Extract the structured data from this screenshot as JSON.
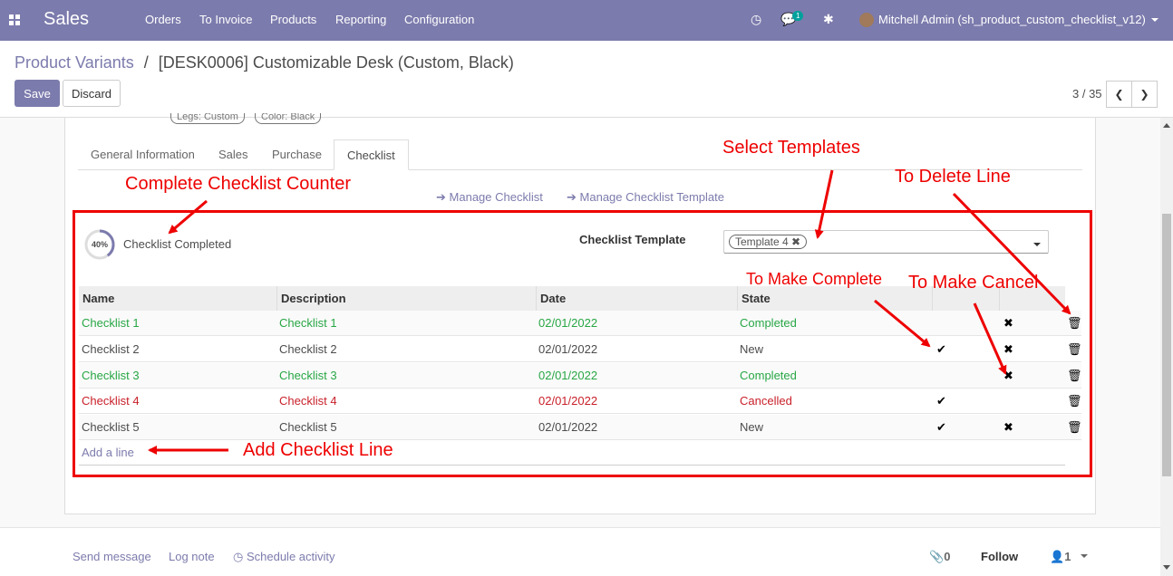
{
  "nav": {
    "app_name": "Sales",
    "menu": [
      "Orders",
      "To Invoice",
      "Products",
      "Reporting",
      "Configuration"
    ],
    "chat_badge": "1",
    "user": "Mitchell Admin (sh_product_custom_checklist_v12)"
  },
  "breadcrumb": {
    "parent": "Product Variants",
    "separator": "/",
    "current": "[DESK0006] Customizable Desk (Custom, Black)"
  },
  "buttons": {
    "save": "Save",
    "discard": "Discard"
  },
  "pager": {
    "value": "3 / 35"
  },
  "tags": [
    "Legs: Custom",
    "Color: Black"
  ],
  "tabs": [
    "General Information",
    "Sales",
    "Purchase",
    "Checklist"
  ],
  "active_tab": "Checklist",
  "actions": {
    "manage_checklist": "Manage Checklist",
    "manage_template": "Manage Checklist Template"
  },
  "progress": {
    "percent_label": "40%",
    "percent": 40,
    "label": "Checklist Completed"
  },
  "template": {
    "label": "Checklist Template",
    "chip": "Template 4"
  },
  "table": {
    "headers": [
      "Name",
      "Description",
      "Date",
      "State"
    ],
    "rows": [
      {
        "name": "Checklist 1",
        "description": "Checklist 1",
        "date": "02/01/2022",
        "state": "Completed",
        "color": "green"
      },
      {
        "name": "Checklist 2",
        "description": "Checklist 2",
        "date": "02/01/2022",
        "state": "New",
        "color": "dark"
      },
      {
        "name": "Checklist 3",
        "description": "Checklist 3",
        "date": "02/01/2022",
        "state": "Completed",
        "color": "green"
      },
      {
        "name": "Checklist 4",
        "description": "Checklist 4",
        "date": "02/01/2022",
        "state": "Cancelled",
        "color": "red"
      },
      {
        "name": "Checklist 5",
        "description": "Checklist 5",
        "date": "02/01/2022",
        "state": "New",
        "color": "dark"
      }
    ],
    "add_line": "Add a line"
  },
  "annotations": {
    "select_templates": "Select Templates",
    "complete_counter": "Complete Checklist Counter",
    "delete_line": "To Delete Line",
    "make_complete": "To Make Complete",
    "make_cancel": "To Make Cancel",
    "add_line": "Add Checklist Line"
  },
  "chatter": {
    "send_message": "Send message",
    "log_note": "Log note",
    "schedule": "Schedule activity",
    "attachments": "0",
    "follow": "Follow",
    "followers": "1"
  },
  "colors": {
    "brand": "#7c7bad",
    "green": "#28a745",
    "red": "#c9202a",
    "annotation": "#e00000"
  }
}
